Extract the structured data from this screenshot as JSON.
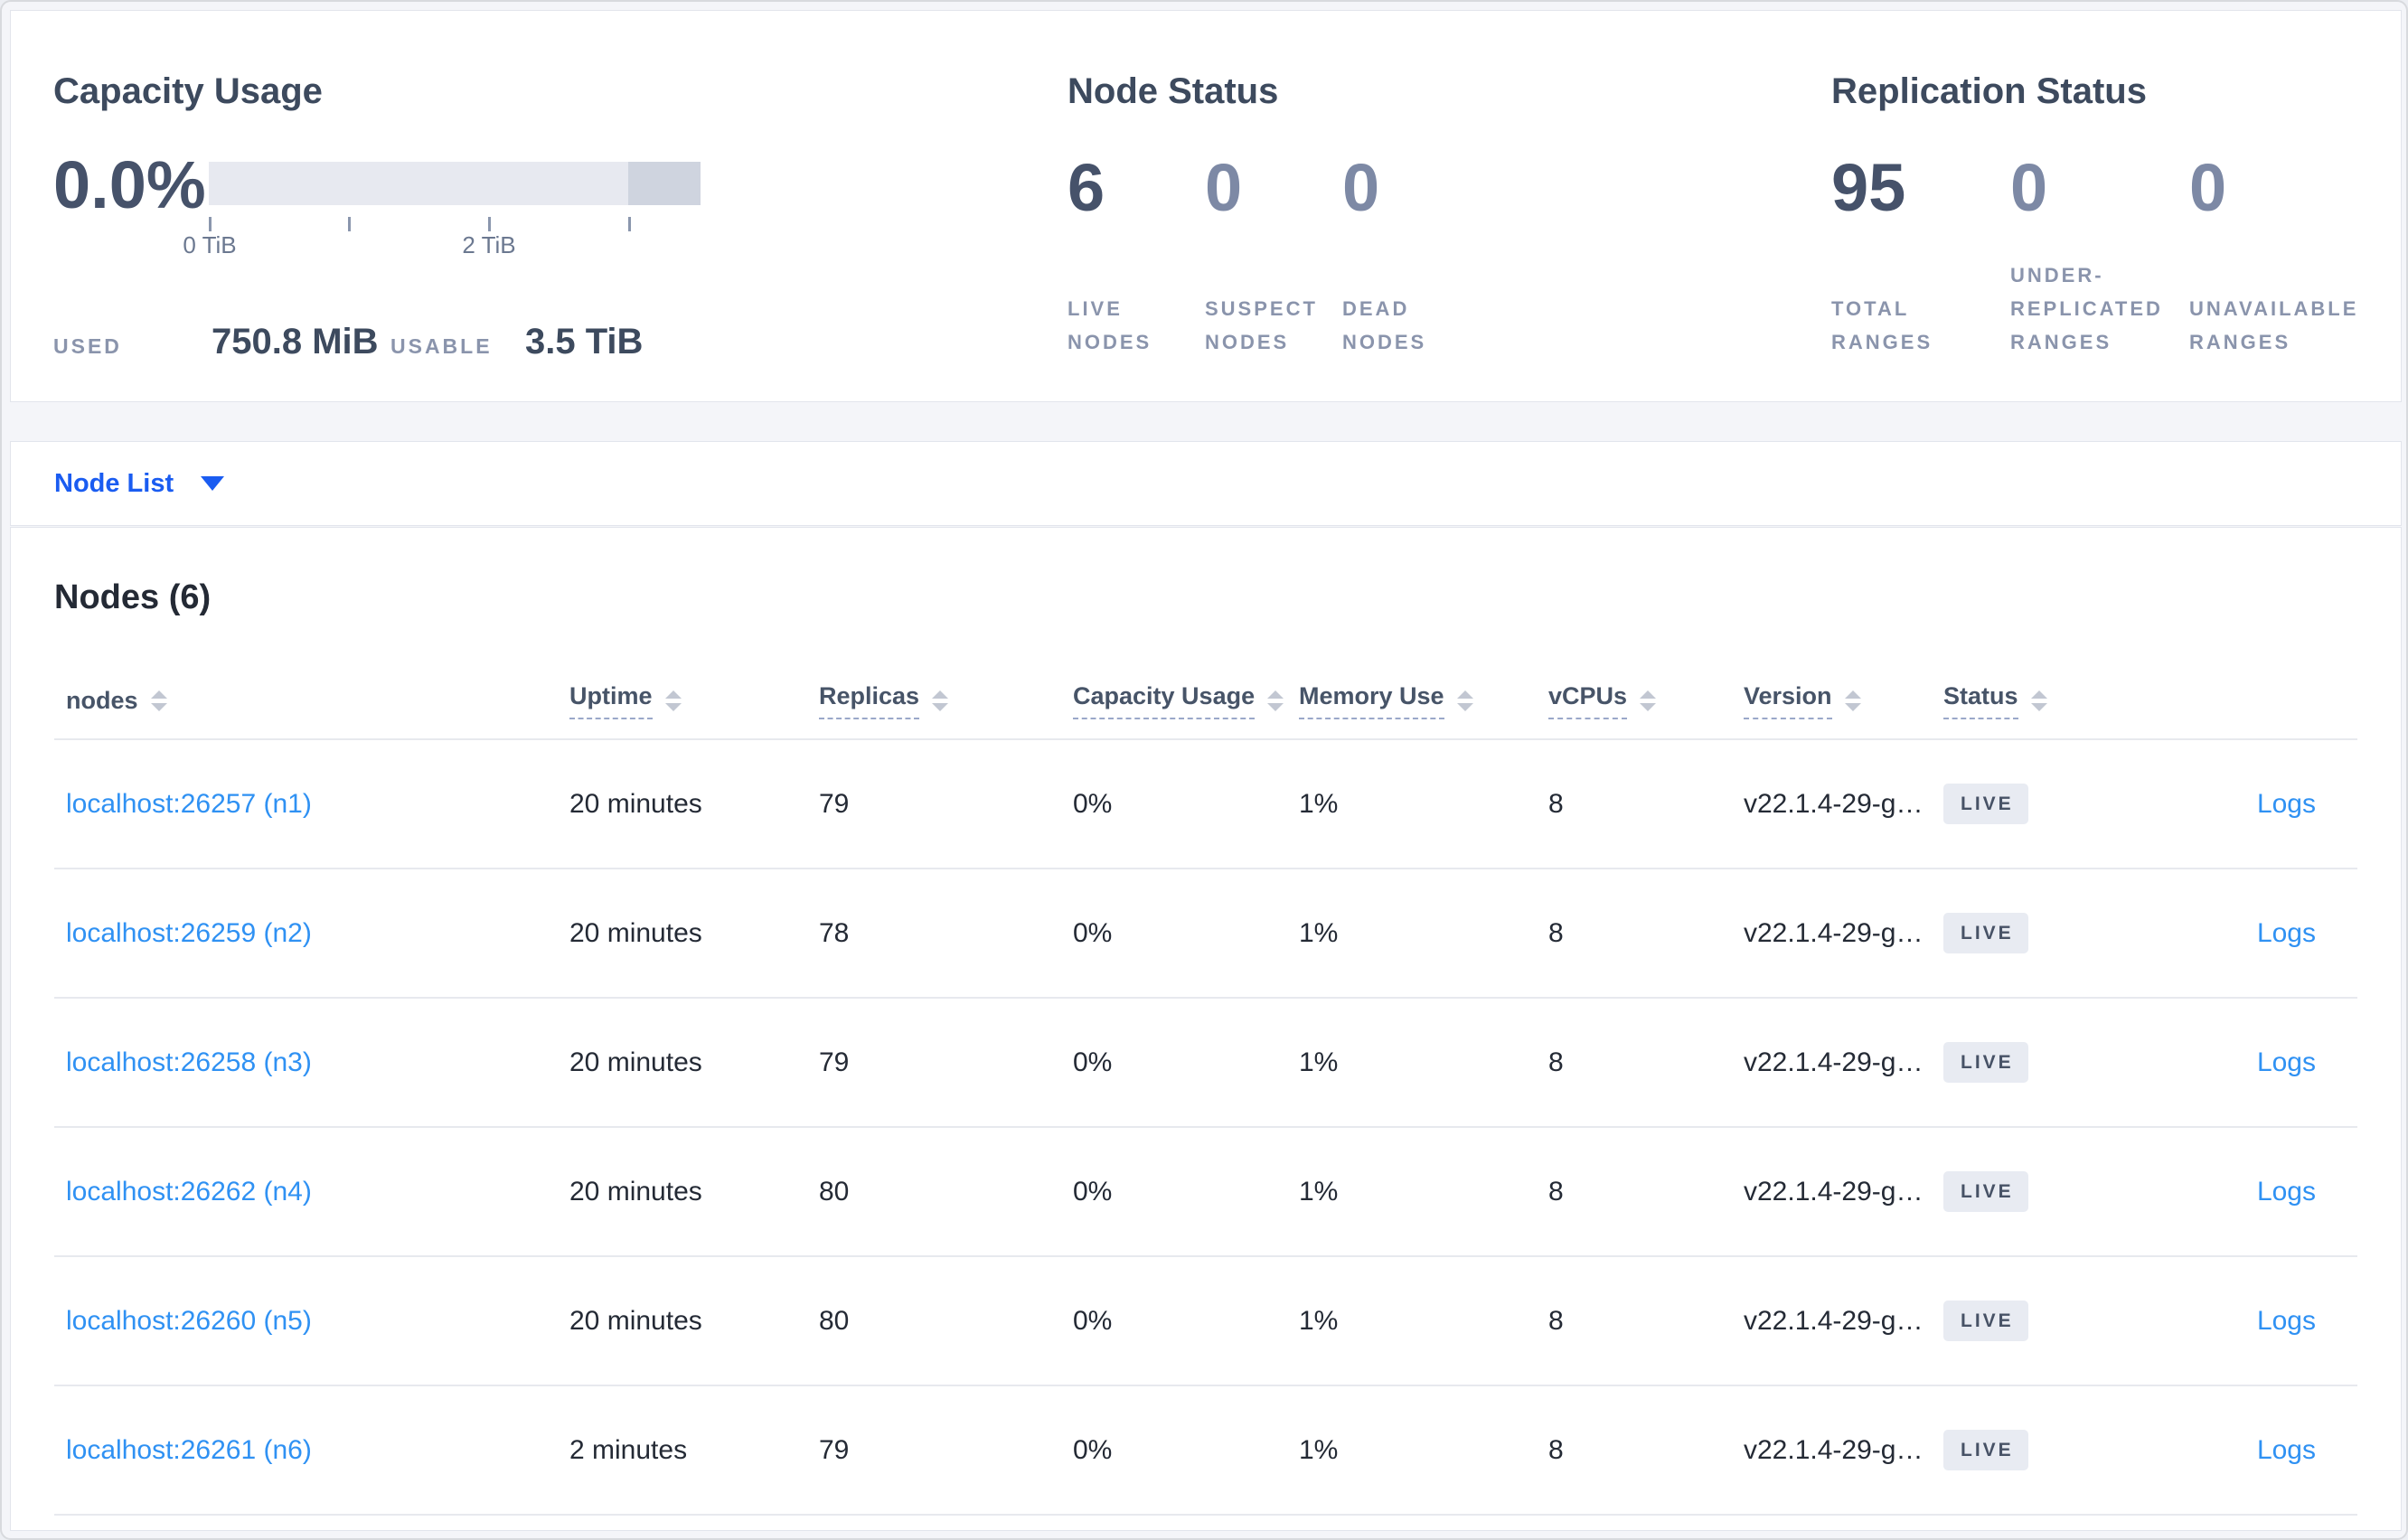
{
  "summary": {
    "capacity": {
      "title": "Capacity Usage",
      "percent": "0.0%",
      "used_label": "USED",
      "used_value": "750.8 MiB",
      "usable_label": "USABLE",
      "usable_value": "3.5 TiB",
      "axis_tick_labels": [
        "0 TiB",
        "2 TiB"
      ],
      "gauge": {
        "axis_max_tib": 3.5,
        "tick_interval_tib": 1,
        "used_fraction": 0.0
      }
    },
    "node_status": {
      "title": "Node Status",
      "stats": [
        {
          "value": "6",
          "label": "LIVE NODES",
          "emphasis": true
        },
        {
          "value": "0",
          "label": "SUSPECT NODES",
          "emphasis": false
        },
        {
          "value": "0",
          "label": "DEAD NODES",
          "emphasis": false
        }
      ]
    },
    "replication": {
      "title": "Replication Status",
      "stats": [
        {
          "value": "95",
          "label": "TOTAL RANGES",
          "emphasis": true
        },
        {
          "value": "0",
          "label": "UNDER-REPLICATED RANGES",
          "emphasis": false
        },
        {
          "value": "0",
          "label": "UNAVAILABLE RANGES",
          "emphasis": false
        }
      ]
    }
  },
  "node_list": {
    "label": "Node List",
    "icon": "chevron-down-icon"
  },
  "nodes_section": {
    "heading": "Nodes (6)",
    "columns": [
      {
        "label": "nodes",
        "underlined": false,
        "sort_icon": "sort-arrows-icon"
      },
      {
        "label": "Uptime",
        "underlined": true,
        "sort_icon": "sort-arrows-icon"
      },
      {
        "label": "Replicas",
        "underlined": true,
        "sort_icon": "sort-arrows-icon"
      },
      {
        "label": "Capacity Usage",
        "underlined": true,
        "sort_icon": "sort-arrows-icon"
      },
      {
        "label": "Memory Use",
        "underlined": true,
        "sort_icon": "sort-arrows-icon"
      },
      {
        "label": "vCPUs",
        "underlined": true,
        "sort_icon": "sort-arrows-icon"
      },
      {
        "label": "Version",
        "underlined": true,
        "sort_icon": "sort-arrows-icon"
      },
      {
        "label": "Status",
        "underlined": true,
        "sort_icon": "sort-arrows-icon"
      }
    ],
    "rows": [
      {
        "node": "localhost:26257 (n1)",
        "uptime": "20 minutes",
        "replicas": "79",
        "capacity_usage": "0%",
        "memory_use": "1%",
        "vcpus": "8",
        "version": "v22.1.4-29-g…",
        "status": "LIVE",
        "logs": "Logs"
      },
      {
        "node": "localhost:26259 (n2)",
        "uptime": "20 minutes",
        "replicas": "78",
        "capacity_usage": "0%",
        "memory_use": "1%",
        "vcpus": "8",
        "version": "v22.1.4-29-g…",
        "status": "LIVE",
        "logs": "Logs"
      },
      {
        "node": "localhost:26258 (n3)",
        "uptime": "20 minutes",
        "replicas": "79",
        "capacity_usage": "0%",
        "memory_use": "1%",
        "vcpus": "8",
        "version": "v22.1.4-29-g…",
        "status": "LIVE",
        "logs": "Logs"
      },
      {
        "node": "localhost:26262 (n4)",
        "uptime": "20 minutes",
        "replicas": "80",
        "capacity_usage": "0%",
        "memory_use": "1%",
        "vcpus": "8",
        "version": "v22.1.4-29-g…",
        "status": "LIVE",
        "logs": "Logs"
      },
      {
        "node": "localhost:26260 (n5)",
        "uptime": "20 minutes",
        "replicas": "80",
        "capacity_usage": "0%",
        "memory_use": "1%",
        "vcpus": "8",
        "version": "v22.1.4-29-g…",
        "status": "LIVE",
        "logs": "Logs"
      },
      {
        "node": "localhost:26261 (n6)",
        "uptime": "2 minutes",
        "replicas": "79",
        "capacity_usage": "0%",
        "memory_use": "1%",
        "vcpus": "8",
        "version": "v22.1.4-29-g…",
        "status": "LIVE",
        "logs": "Logs"
      }
    ]
  },
  "colors": {
    "accent_blue": "#1a5cf1",
    "link_blue": "#2f91f3",
    "stat_dark": "#46526a",
    "stat_muted": "#7d89a5",
    "badge_bg": "#e8ebf2"
  }
}
